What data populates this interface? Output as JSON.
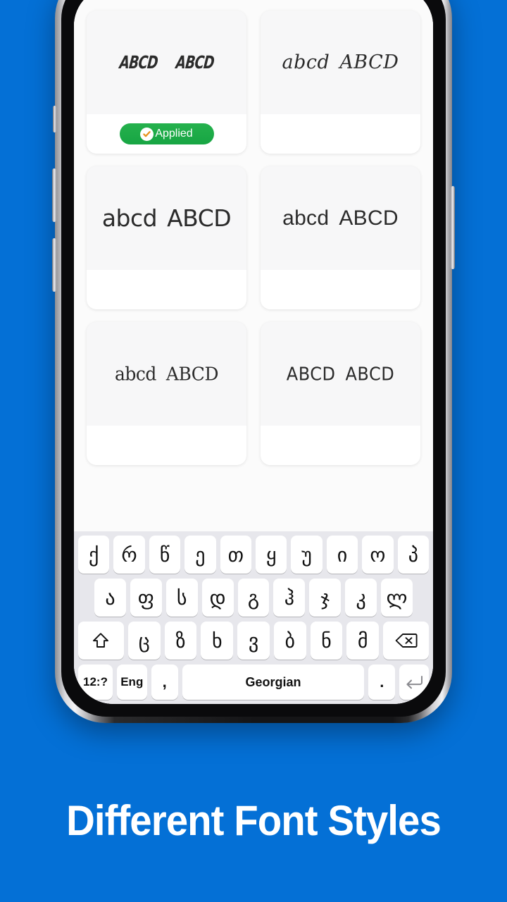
{
  "background_color": "#0470d6",
  "headline": "Different Font Styles",
  "app": {
    "font_cards": [
      {
        "sample_lower": "ABCD",
        "sample_upper": "ABCD",
        "style": "pv-stencil",
        "applied": true,
        "applied_label": "Applied",
        "applied_color": "#19a844"
      },
      {
        "sample_lower": "abcd",
        "sample_upper": "ABCD",
        "style": "pv-script",
        "applied": false,
        "applied_label": "",
        "applied_color": ""
      },
      {
        "sample_lower": "abcd",
        "sample_upper": "ABCD",
        "style": "pv-rounded",
        "applied": false,
        "applied_label": "",
        "applied_color": ""
      },
      {
        "sample_lower": "abcd",
        "sample_upper": "ABCD",
        "style": "pv-thin",
        "applied": false,
        "applied_label": "",
        "applied_color": ""
      },
      {
        "sample_lower": "abcd",
        "sample_upper": "ABCD",
        "style": "pv-gothic",
        "applied": false,
        "applied_label": "",
        "applied_color": ""
      },
      {
        "sample_lower": "ABCD",
        "sample_upper": "ABCD",
        "style": "pv-deco",
        "applied": false,
        "applied_label": "",
        "applied_color": ""
      }
    ]
  },
  "keyboard": {
    "language_label": "Georgian",
    "row1": [
      "ქ",
      "რ",
      "წ",
      "ე",
      "თ",
      "ყ",
      "უ",
      "ი",
      "ო",
      "პ"
    ],
    "row2": [
      "ა",
      "ფ",
      "ს",
      "დ",
      "გ",
      "ჰ",
      "ჯ",
      "კ",
      "ლ"
    ],
    "row3": {
      "shift_icon": "shift-arrow-icon",
      "keys": [
        "ც",
        "ზ",
        "ხ",
        "ვ",
        "ბ",
        "ნ",
        "მ"
      ],
      "backspace_icon": "backspace-icon"
    },
    "row4": {
      "numeric_label": "12:?",
      "language_switch_label": "Eng",
      "comma_label": ",",
      "space_label": "Georgian",
      "period_label": ".",
      "enter_icon": "return-icon"
    }
  }
}
